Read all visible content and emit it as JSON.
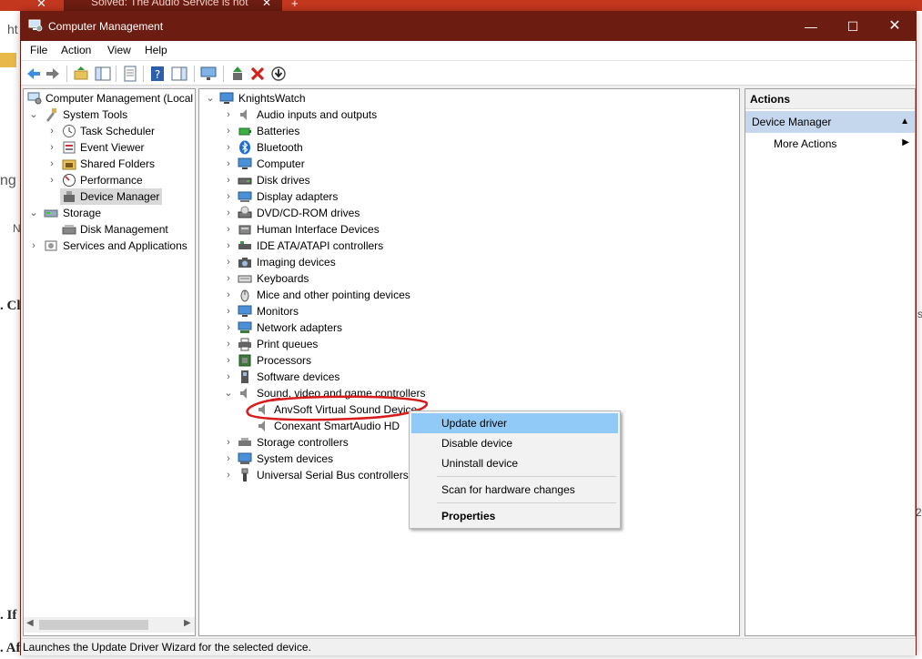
{
  "browser": {
    "tab_title": "Solved: The Audio Service is not",
    "close_glyph": "✕",
    "new_tab_glyph": "+",
    "fragments": {
      "addr": "ht",
      "left_a": "ng",
      "left_b": "N",
      "left_c": ". Cl",
      "left_d": ". If",
      "left_e": ". Af",
      "right_a": "s",
      "right_b": "2"
    }
  },
  "window": {
    "title": "Computer Management",
    "minimize": "—",
    "maximize": "☐",
    "close": "✕"
  },
  "menu": [
    "File",
    "Action",
    "View",
    "Help"
  ],
  "left_tree": {
    "root": "Computer Management (Local",
    "system_tools": "System Tools",
    "task_scheduler": "Task Scheduler",
    "event_viewer": "Event Viewer",
    "shared_folders": "Shared Folders",
    "performance": "Performance",
    "device_manager": "Device Manager",
    "storage": "Storage",
    "disk_management": "Disk Management",
    "services": "Services and Applications"
  },
  "device_tree": {
    "root": "KnightsWatch",
    "categories": [
      "Audio inputs and outputs",
      "Batteries",
      "Bluetooth",
      "Computer",
      "Disk drives",
      "Display adapters",
      "DVD/CD-ROM drives",
      "Human Interface Devices",
      "IDE ATA/ATAPI controllers",
      "Imaging devices",
      "Keyboards",
      "Mice and other pointing devices",
      "Monitors",
      "Network adapters",
      "Print queues",
      "Processors",
      "Software devices",
      "Sound, video and game controllers"
    ],
    "sound_children": [
      "AnvSoft Virtual Sound Device",
      "Conexant SmartAudio HD"
    ],
    "more_categories": [
      "Storage controllers",
      "System devices",
      "Universal Serial Bus controllers"
    ]
  },
  "actions": {
    "header": "Actions",
    "section": "Device Manager",
    "more": "More Actions"
  },
  "context_menu": {
    "update_driver": "Update driver",
    "disable": "Disable device",
    "uninstall": "Uninstall device",
    "scan": "Scan for hardware changes",
    "properties": "Properties"
  },
  "status": "Launches the Update Driver Wizard for the selected device.",
  "colors": {
    "titlebar": "#6c1c10",
    "menu_highlight": "#91c9f7",
    "actions_section": "#c5d7ec",
    "annotation": "#d81c1c"
  }
}
